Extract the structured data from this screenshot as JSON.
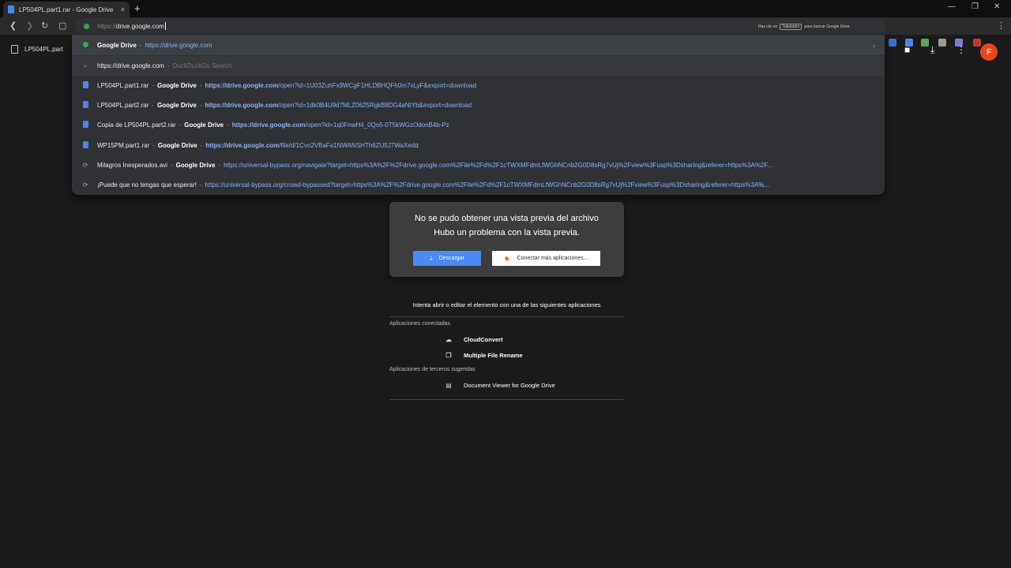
{
  "browser": {
    "tab_title": "LP504PL.part1.rar - Google Drive",
    "tab_close": "×",
    "new_tab": "+",
    "window_controls": [
      "—",
      "❐",
      "✕"
    ]
  },
  "omnibox": {
    "prefix": "https://",
    "text": "drive.google.com"
  },
  "hint": {
    "before": "Haz clic en",
    "key": "Tabulador",
    "after": "para buscar Google Drive"
  },
  "suggestions": [
    {
      "icon": "dot",
      "title": "",
      "bold": "Google Drive",
      "url": "https://drive.google.com",
      "url_rest": "",
      "selected": true
    },
    {
      "icon": "search",
      "title": "https://drive.google.com",
      "bold": "",
      "url": "",
      "muted": "DuckDuckGo Search"
    },
    {
      "icon": "doc",
      "title": "LP504PL.part1.rar",
      "bold": "Google Drive",
      "url": "https://drive.google.com",
      "url_rest": "/open?id=1U03ZuhFx9WCgF1HLDBHQFh0m7xLyF&export=download"
    },
    {
      "icon": "doc",
      "title": "LP504PL.part2.rar",
      "bold": "Google Drive",
      "url": "https://drive.google.com",
      "url_rest": "/open?id=1dk0B4U9d7MLZ0625RgkB8DG4aNtYb&export=download"
    },
    {
      "icon": "doc",
      "title": "Copia de LP504PL.part2.rar",
      "bold": "Google Drive",
      "url": "https://drive.google.com",
      "url_rest": "/open?id=1q0FnwH4_0Qo5-0T5kWGzOdonB4b-Pz"
    },
    {
      "icon": "doc",
      "title": "WP15PM.part1.rar",
      "bold": "Google Drive",
      "url": "https://drive.google.com",
      "url_rest": "/file/d/1Cvo2VBaFa1NWANSHTh6ZU5J7WaXedd"
    },
    {
      "icon": "dot",
      "title": "Milagros Inesperados.avi",
      "bold": "Google Drive",
      "url": "https://universal-bypass.org/navigate?target=",
      "url_rest": "https%3A%2F%2Fdrive.google.com%2File%2Fd%2F1cTWXMFdmLfWGhNCnb2G0D8sRg7vUj%2Fview%3Fusp%3Dsharing&referer=https%3A%2F..."
    },
    {
      "icon": "dot",
      "title": "¡Puede que no tengas que esperar!",
      "bold": "",
      "url": "https://universal-bypass.org/crowd-bypassed?target=",
      "url_rest": "https%3A%2F%2Fdrive.google.com%2File%2Fd%2F1cTWXMFdmLfWGhNCnb2G0D8sRg7vUj%2Fview%3Fusp%3Dsharing&referer=https%3A%..."
    }
  ],
  "drive": {
    "file_name": "LP504PL.part",
    "avatar_letter": "F"
  },
  "preview": {
    "line1": "No se pudo obtener una vista previa del archivo",
    "line2": "Hubo un problema con la vista previa.",
    "download_label": "Descargar",
    "connect_label": "Conectar más aplicaciones..."
  },
  "apps": {
    "intro": "Intenta abrir o editar el elemento con una de las siguientes aplicaciones",
    "connected_heading": "Aplicaciones conectadas",
    "connected": [
      "CloudConvert",
      "Multiple File Rename"
    ],
    "third_party_heading": "Aplicaciones de terceros sugeridas",
    "third_party": [
      "Document Viewer for Google Drive"
    ]
  },
  "colors": {
    "background": "#1b1b1b",
    "dropdown": "#303134",
    "link": "#8ab4f8",
    "download_button": "#4a8af4",
    "avatar": "#e8461b"
  }
}
